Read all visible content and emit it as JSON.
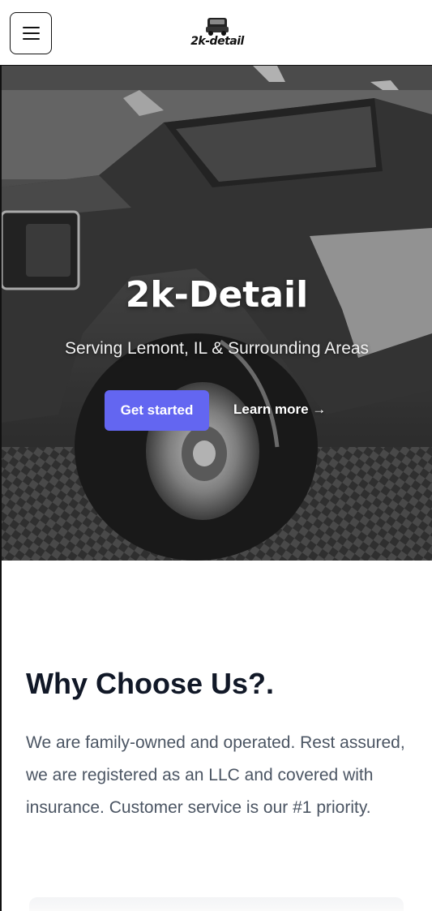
{
  "header": {
    "menu_icon": "hamburger-menu-icon",
    "logo_text": "2k-detail"
  },
  "hero": {
    "title": "2k-Detail",
    "subtitle": "Serving Lemont, IL & Surrounding Areas",
    "primary_button": "Get started",
    "secondary_link": "Learn more →",
    "accent_color": "#6366f1"
  },
  "why": {
    "title": "Why Choose Us?.",
    "body": "We are family-owned and operated. Rest assured, we are registered as an LLC and covered with insurance. Customer service is our #1 priority."
  }
}
